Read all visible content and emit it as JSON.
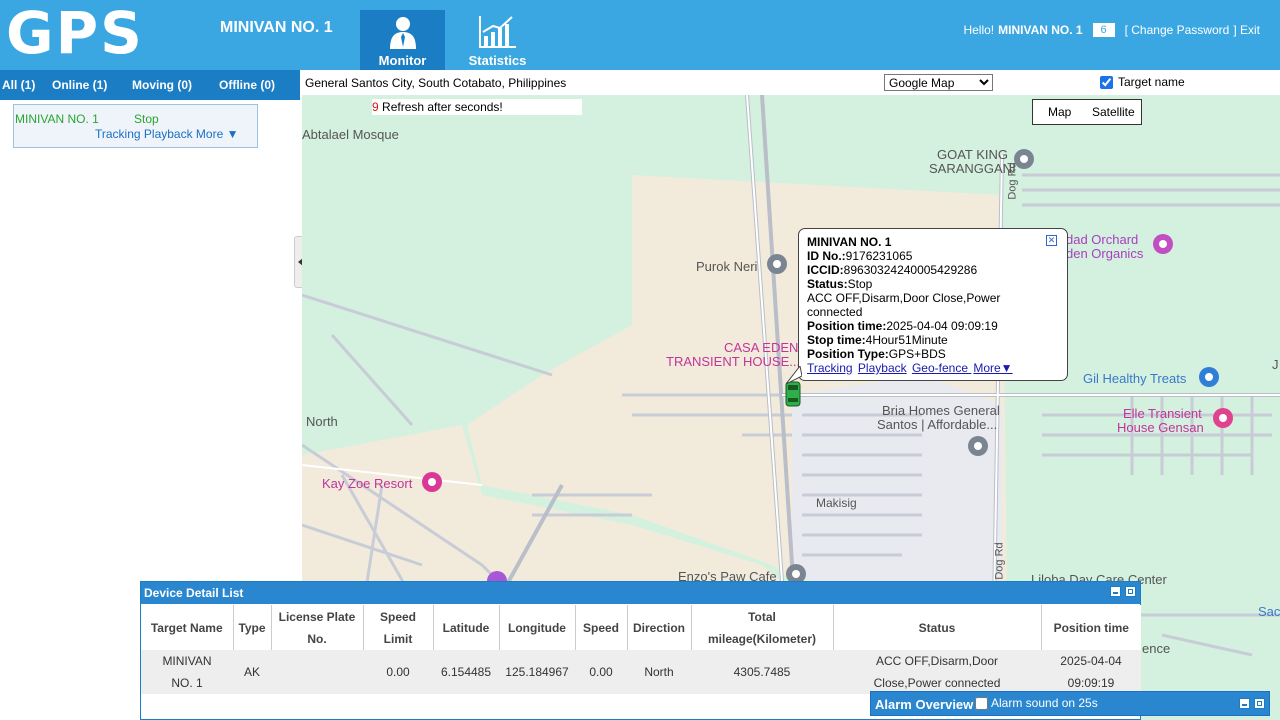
{
  "header": {
    "logo": "GPS",
    "vehicle_title": "MINIVAN NO. 1",
    "nav": [
      {
        "label": "Monitor",
        "icon": "monitor-user-icon"
      },
      {
        "label": "Statistics",
        "icon": "statistics-chart-icon"
      }
    ],
    "greeting": "Hello!",
    "username": "MINIVAN NO. 1",
    "message_count": "6",
    "change_password": "[ Change Password",
    "exit": "] Exit"
  },
  "filters": {
    "all": "All (1)",
    "online": "Online (1)",
    "moving": "Moving (0)",
    "offline": "Offline (0)"
  },
  "vehicle_card": {
    "name": "MINIVAN NO. 1",
    "status": "Stop",
    "links": "Tracking Playback More ▼"
  },
  "map_bar": {
    "address": "General Santos City, South Cotabato, Philippines",
    "map_provider": "Google Map",
    "target_name_label": "Target name"
  },
  "map": {
    "refresh_seconds": "9",
    "refresh_text": "Refresh after seconds!",
    "map_type": "Map",
    "satellite_type": "Satellite",
    "labels": {
      "abtalael": "Abtalael Mosque",
      "goat_king_1": "GOAT KING",
      "goat_king_2": "SARANGGANI",
      "purok_neri": "Purok Neri",
      "casa_eden_1": "CASA EDEN",
      "casa_eden_2": "TRANSIENT HOUSE...",
      "north": "North",
      "kay_zoe": "Kay Zoe Resort",
      "bria_1": "Bria Homes General",
      "bria_2": "Santos | Affordable...",
      "gil": "Gil Healthy Treats",
      "elle_1": "Elle Transient",
      "elle_2": "House Gensan",
      "makisig": "Makisig",
      "enzos": "Enzo's Paw Cafe",
      "liloba": "Liloba Day Care Center",
      "orchard_1": "dad Orchard",
      "orchard_2": "den Organics",
      "road_1": "Dog Rd",
      "road_2": "Dog Rd",
      "sac": "Sac",
      "ence": "ence",
      "j": "J"
    }
  },
  "popup": {
    "title": "MINIVAN NO. 1",
    "id_label": "ID No.:",
    "id_value": "9176231065",
    "iccid_label": "ICCID:",
    "iccid_value": "89630324240005429286",
    "status_label": "Status:",
    "status_value": "Stop",
    "state_line": "ACC OFF,Disarm,Door Close,Power connected",
    "pos_time_label": "Position time:",
    "pos_time_value": "2025-04-04 09:09:19",
    "stop_time_label": "Stop time:",
    "stop_time_value": "4Hour51Minute",
    "pos_type_label": "Position Type:",
    "pos_type_value": "GPS+BDS",
    "link_tracking": "Tracking",
    "link_playback": "Playback",
    "link_geofence": " Geo-fence ",
    "link_more": "More▼"
  },
  "detail_list": {
    "title": "Device Detail List",
    "columns": {
      "target_name": "Target Name",
      "type": "Type",
      "license_1": "License Plate",
      "license_2": "No.",
      "speed_limit_1": "Speed",
      "speed_limit_2": "Limit",
      "latitude": "Latitude",
      "longitude": "Longitude",
      "speed": "Speed",
      "direction": "Direction",
      "mileage_1": "Total",
      "mileage_2": "mileage(Kilometer)",
      "status": "Status",
      "position_time": "Position time"
    },
    "row": {
      "target_name_1": "MINIVAN",
      "target_name_2": "NO. 1",
      "type": "AK",
      "license": "",
      "speed_limit": "0.00",
      "latitude": "6.154485",
      "longitude": "125.184967",
      "speed": "0.00",
      "direction": "North",
      "mileage": "4305.7485",
      "status_1": "ACC OFF,Disarm,Door",
      "status_2": "Close,Power connected",
      "time_1": "2025-04-04",
      "time_2": "09:09:19"
    }
  },
  "alarm": {
    "title": "Alarm Overview",
    "sound_label": "Alarm sound on 25s"
  },
  "colors": {
    "header_blue": "#3aa7e3",
    "nav_active": "#1b7dc4",
    "online_green": "#2aa530",
    "map_bg": "#d4f0df"
  }
}
